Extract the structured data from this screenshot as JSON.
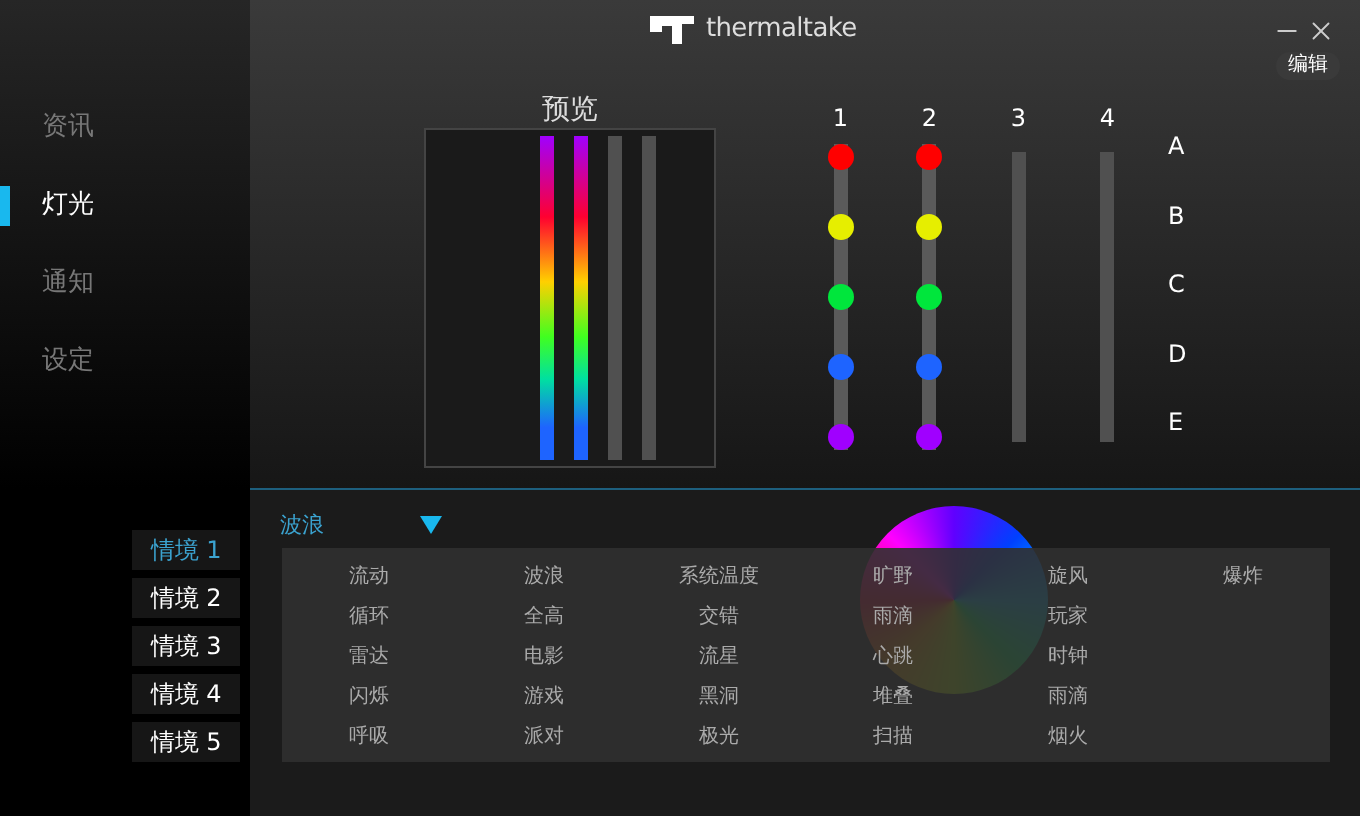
{
  "window": {
    "brand": "thermaltake",
    "edit_button": "编辑"
  },
  "sidebar": {
    "items": [
      {
        "label": "资讯",
        "selected": false
      },
      {
        "label": "灯光",
        "selected": true
      },
      {
        "label": "通知",
        "selected": false
      },
      {
        "label": "设定",
        "selected": false
      }
    ]
  },
  "preview": {
    "title": "预览",
    "strips": [
      {
        "lit": true
      },
      {
        "lit": true
      },
      {
        "lit": false
      },
      {
        "lit": false
      }
    ]
  },
  "channels": [
    {
      "label": "1",
      "leds": [
        {
          "color": "#ff0000"
        },
        {
          "color": "#e6ee00"
        },
        {
          "color": "#00e63c"
        },
        {
          "color": "#1e64ff"
        },
        {
          "color": "#a000ff"
        }
      ]
    },
    {
      "label": "2",
      "leds": [
        {
          "color": "#ff0000"
        },
        {
          "color": "#e6ee00"
        },
        {
          "color": "#00e63c"
        },
        {
          "color": "#1e64ff"
        },
        {
          "color": "#a000ff"
        }
      ]
    },
    {
      "label": "3"
    },
    {
      "label": "4"
    }
  ],
  "rows": [
    "A",
    "B",
    "C",
    "D",
    "E"
  ],
  "scenes": [
    {
      "label": "情境 1",
      "selected": true
    },
    {
      "label": "情境 2",
      "selected": false
    },
    {
      "label": "情境 3",
      "selected": false
    },
    {
      "label": "情境 4",
      "selected": false
    },
    {
      "label": "情境 5",
      "selected": false
    }
  ],
  "effect_select": {
    "value": "波浪",
    "expanded": true
  },
  "effect_menu": [
    [
      "流动",
      "循环",
      "雷达",
      "闪烁",
      "呼吸"
    ],
    [
      "波浪",
      "全高",
      "电影",
      "游戏",
      "派对"
    ],
    [
      "系统温度",
      "交错",
      "流星",
      "黑洞",
      "极光"
    ],
    [
      "旷野",
      "雨滴",
      "心跳",
      "堆叠",
      "扫描"
    ],
    [
      "旋风",
      "玩家",
      "时钟",
      "雨滴",
      "烟火"
    ],
    [
      "爆炸"
    ]
  ]
}
